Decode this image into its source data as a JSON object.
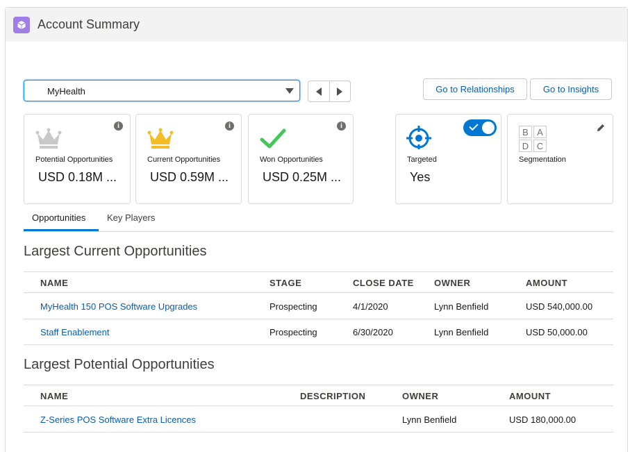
{
  "header": {
    "title": "Account Summary",
    "icon": "cube-icon",
    "icon_color": "#9f7fe6"
  },
  "account_select": {
    "value": "MyHealth"
  },
  "buttons": {
    "relationships": "Go to Relationships",
    "insights": "Go to Insights"
  },
  "cards": [
    {
      "label": "Potential Opportunities",
      "value": "USD 0.18M ...",
      "icon": "crown-icon",
      "icon_color": "#c9c9c9"
    },
    {
      "label": "Current Opportunities",
      "value": "USD 0.59M ...",
      "icon": "crown-icon",
      "icon_color": "#f4bc25"
    },
    {
      "label": "Won Opportunities",
      "value": "USD 0.25M ...",
      "icon": "checkmark-icon",
      "icon_color": "#45c65a"
    },
    {
      "label": "Targeted",
      "value": "Yes",
      "icon": "target-icon",
      "icon_color": "#0176d3",
      "toggle_on": true
    },
    {
      "label": "Segmentation",
      "grid": [
        "B",
        "A",
        "D",
        "C"
      ]
    }
  ],
  "tabs": [
    "Opportunities",
    "Key Players"
  ],
  "current_section": {
    "title": "Largest Current Opportunities",
    "columns": [
      "NAME",
      "STAGE",
      "CLOSE DATE",
      "OWNER",
      "AMOUNT"
    ],
    "rows": [
      [
        "MyHealth 150 POS Software Upgrades",
        "Prospecting",
        "4/1/2020",
        "Lynn Benfield",
        "USD 540,000.00"
      ],
      [
        "Staff Enablement",
        "Prospecting",
        "6/30/2020",
        "Lynn Benfield",
        "USD 50,000.00"
      ]
    ]
  },
  "potential_section": {
    "title": "Largest Potential Opportunities",
    "columns": [
      "NAME",
      "DESCRIPTION",
      "OWNER",
      "AMOUNT"
    ],
    "rows": [
      [
        "Z-Series POS Software Extra Licences",
        "",
        "Lynn Benfield",
        "USD 180,000.00"
      ]
    ]
  },
  "colors": {
    "brand": "#0176d3",
    "link": "#0b5cab",
    "border": "#dddbda"
  }
}
